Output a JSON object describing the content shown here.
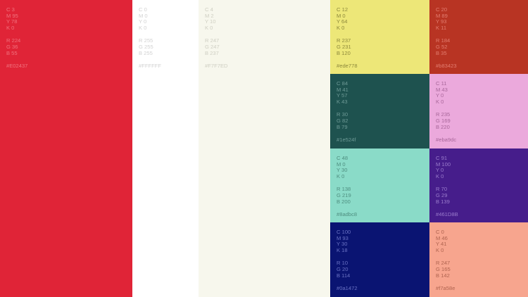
{
  "swatches": [
    {
      "id": "red",
      "bg": "#e02437",
      "text_color": "#f0727e",
      "cmyk": [
        "C 3",
        "M 95",
        "Y 78",
        "K 0"
      ],
      "rgb": [
        "R 224",
        "G 36",
        "B 55"
      ],
      "hex": "#E02437"
    },
    {
      "id": "white",
      "bg": "#ffffff",
      "text_color": "#d2d2d2",
      "cmyk": [
        "C 0",
        "M 0",
        "Y 0",
        "K 0"
      ],
      "rgb": [
        "R 255",
        "G 255",
        "B 255"
      ],
      "hex": "#FFFFFF"
    },
    {
      "id": "cream",
      "bg": "#f7f7ed",
      "text_color": "#cfcfc3",
      "cmyk": [
        "C 4",
        "M 2",
        "Y 10",
        "K 0"
      ],
      "rgb": [
        "R 247",
        "G 247",
        "B 237"
      ],
      "hex": "#F7F7ED"
    },
    {
      "id": "yellow",
      "bg": "#ede778",
      "text_color": "#8e8a3c",
      "cmyk": [
        "C 12",
        "M 0",
        "Y 64",
        "K 0"
      ],
      "rgb": [
        "R 237",
        "G 231",
        "B 120"
      ],
      "hex": "#ede778"
    },
    {
      "id": "rust",
      "bg": "#b83423",
      "text_color": "#e27d70",
      "cmyk": [
        "C 20",
        "M 89",
        "Y 93",
        "K 11"
      ],
      "rgb": [
        "R 184",
        "G 52",
        "B 35"
      ],
      "hex": "#b83423"
    },
    {
      "id": "forest",
      "bg": "#1e524f",
      "text_color": "#6e9a96",
      "cmyk": [
        "C 84",
        "M 41",
        "Y 57",
        "K 43"
      ],
      "rgb": [
        "R 30",
        "G 82",
        "B 79"
      ],
      "hex": "#1e524f"
    },
    {
      "id": "pink",
      "bg": "#eba9dc",
      "text_color": "#a8679a",
      "cmyk": [
        "C 11",
        "M 43",
        "Y 0",
        "K 0"
      ],
      "rgb": [
        "R 235",
        "G 169",
        "B 220"
      ],
      "hex": "#eba9dc"
    },
    {
      "id": "mint",
      "bg": "#8adbc8",
      "text_color": "#4f8f80",
      "cmyk": [
        "C 48",
        "M 0",
        "Y 30",
        "K 0"
      ],
      "rgb": [
        "R 138",
        "G 219",
        "B 200"
      ],
      "hex": "#8adbc8"
    },
    {
      "id": "purple",
      "bg": "#461d8b",
      "text_color": "#9a7ccc",
      "cmyk": [
        "C 91",
        "M 100",
        "Y 0",
        "K 0"
      ],
      "rgb": [
        "R 70",
        "G 29",
        "B 139"
      ],
      "hex": "#461D8B"
    },
    {
      "id": "navy",
      "bg": "#0a1472",
      "text_color": "#6a72c4",
      "cmyk": [
        "C 100",
        "M 93",
        "Y 30",
        "K 18"
      ],
      "rgb": [
        "R 10",
        "G 20",
        "B 114"
      ],
      "hex": "#0a1472"
    },
    {
      "id": "salmon",
      "bg": "#f7a58e",
      "text_color": "#b06450",
      "cmyk": [
        "C 0",
        "M 46",
        "Y 41",
        "K 0"
      ],
      "rgb": [
        "R 247",
        "G 165",
        "B 142"
      ],
      "hex": "#f7a58e"
    }
  ]
}
